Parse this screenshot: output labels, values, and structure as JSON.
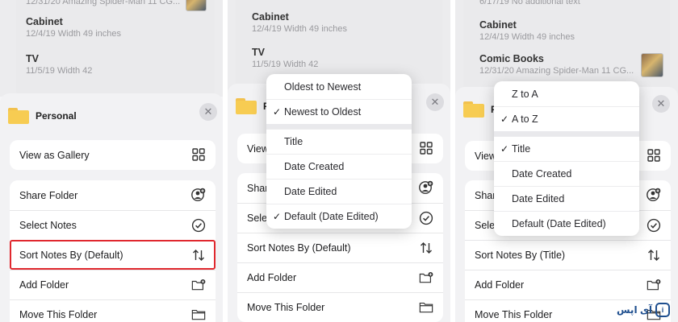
{
  "panels": [
    {
      "notes": [
        {
          "title": "",
          "meta": "12/31/20  Amazing Spider-Man 11 CG..."
        },
        {
          "title": "Cabinet",
          "meta": "12/4/19  Width 49 inches"
        },
        {
          "title": "TV",
          "meta": "11/5/19  Width 42"
        }
      ],
      "folder": "Personal",
      "close": "✕",
      "group1": [
        "View as Gallery"
      ],
      "group2": [
        "Share Folder",
        "Select Notes",
        "Sort Notes By (Default)",
        "Add Folder",
        "Move This Folder"
      ]
    },
    {
      "notes": [
        {
          "title": "Cabinet",
          "meta": "12/4/19  Width 49 inches"
        },
        {
          "title": "TV",
          "meta": "11/5/19  Width 42"
        }
      ],
      "folder": "P",
      "close": "✕",
      "group1": [
        "View"
      ],
      "group2": [
        "Share",
        "Selec",
        "Sort Notes By (Default)",
        "Add Folder",
        "Move This Folder"
      ],
      "menu_top": [
        "Oldest to Newest",
        "Newest to Oldest"
      ],
      "menu_bottom": [
        "Title",
        "Date Created",
        "Date Edited",
        "Default (Date Edited)"
      ]
    },
    {
      "notes": [
        {
          "title": "",
          "meta": "6/17/19  No additional text"
        },
        {
          "title": "Cabinet",
          "meta": "12/4/19  Width 49 inches"
        },
        {
          "title": "Comic Books",
          "meta": "12/31/20  Amazing Spider-Man 11 CG..."
        }
      ],
      "folder": "P",
      "close": "✕",
      "group1": [
        "View"
      ],
      "group2": [
        "Share",
        "Selec",
        "Sort Notes By (Title)",
        "Add Folder",
        "Move This Folder"
      ],
      "menu_top": [
        "Z to A",
        "A to Z"
      ],
      "menu_bottom": [
        "Title",
        "Date Created",
        "Date Edited",
        "Default (Date Edited)"
      ]
    }
  ],
  "checkmark": "✓",
  "brand": "آی اپس",
  "brand_badge": "i"
}
